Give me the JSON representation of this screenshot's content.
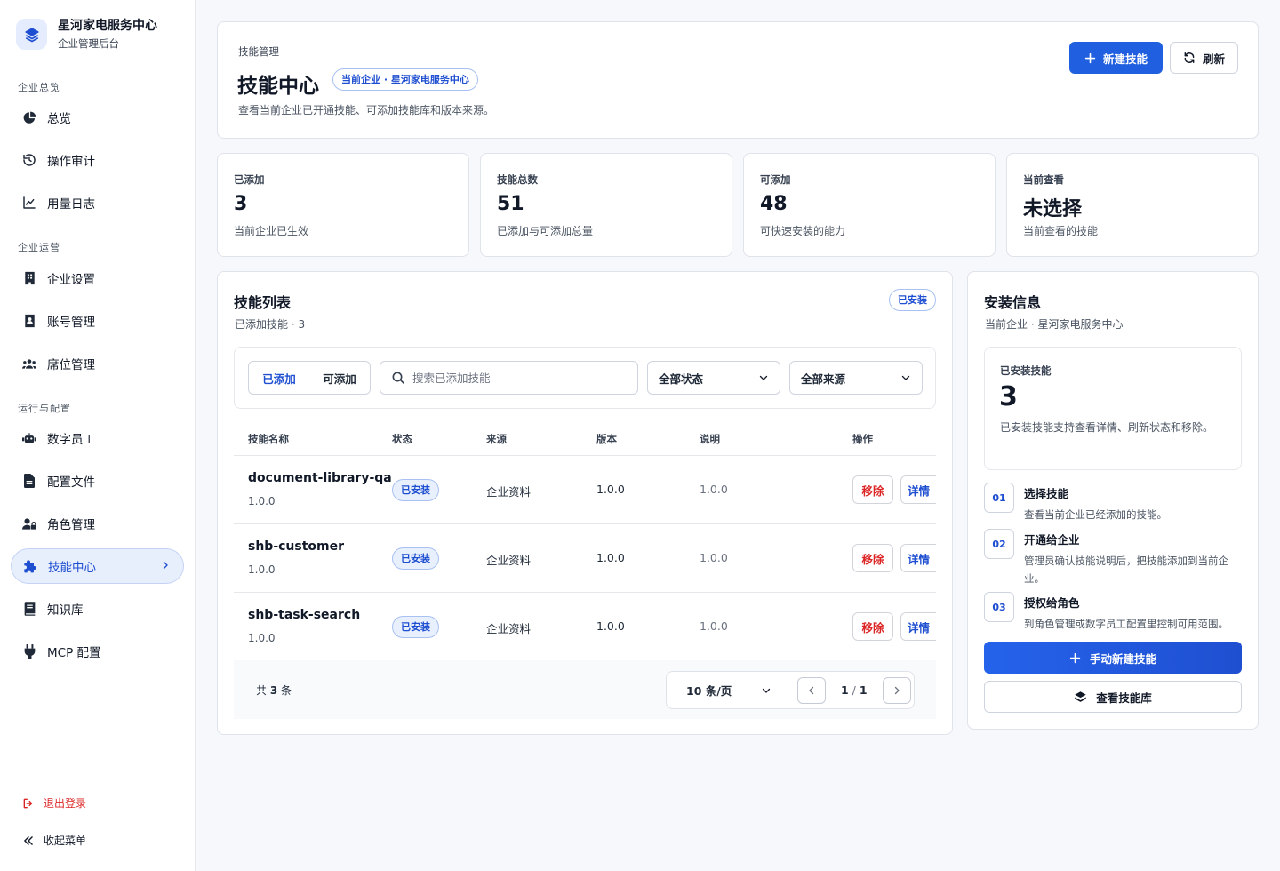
{
  "brand": {
    "name": "星河家电服务中心",
    "subtitle": "企业管理后台"
  },
  "sidebar": {
    "sections": [
      "企业总览",
      "企业运营",
      "运行与配置"
    ],
    "items": [
      {
        "label": "总览",
        "icon": "pie-chart-icon"
      },
      {
        "label": "操作审计",
        "icon": "history-icon"
      },
      {
        "label": "用量日志",
        "icon": "line-chart-icon"
      },
      {
        "label": "企业设置",
        "icon": "building-icon"
      },
      {
        "label": "账号管理",
        "icon": "id-card-icon"
      },
      {
        "label": "席位管理",
        "icon": "users-icon"
      },
      {
        "label": "数字员工",
        "icon": "robot-icon"
      },
      {
        "label": "配置文件",
        "icon": "file-icon"
      },
      {
        "label": "角色管理",
        "icon": "user-lock-icon"
      },
      {
        "label": "技能中心",
        "icon": "puzzle-icon",
        "active": true
      },
      {
        "label": "知识库",
        "icon": "book-icon"
      },
      {
        "label": "MCP 配置",
        "icon": "plug-icon"
      }
    ],
    "logout": "退出登录",
    "collapse": "收起菜单"
  },
  "header": {
    "breadcrumb": "技能管理",
    "title": "技能中心",
    "badge": "当前企业 · 星河家电服务中心",
    "description": "查看当前企业已开通技能、可添加技能库和版本来源。",
    "new_button": "新建技能",
    "refresh_button": "刷新"
  },
  "stats": [
    {
      "label": "已添加",
      "value": "3",
      "desc": "当前企业已生效"
    },
    {
      "label": "技能总数",
      "value": "51",
      "desc": "已添加与可添加总量"
    },
    {
      "label": "可添加",
      "value": "48",
      "desc": "可快速安装的能力"
    },
    {
      "label": "当前查看",
      "value": "未选择",
      "desc": "当前查看的技能"
    }
  ],
  "list": {
    "title": "技能列表",
    "subtitle": "已添加技能 · 3",
    "badge": "已安装",
    "tabs": [
      "已添加",
      "可添加"
    ],
    "search_placeholder": "搜索已添加技能",
    "status_filter": "全部状态",
    "source_filter": "全部来源",
    "columns": [
      "技能名称",
      "状态",
      "来源",
      "版本",
      "说明",
      "操作"
    ],
    "rows": [
      {
        "name": "document-library-qa",
        "version_sub": "1.0.0",
        "status": "已安装",
        "source": "企业资料",
        "version": "1.0.0",
        "desc": "1.0.0"
      },
      {
        "name": "shb-customer",
        "version_sub": "1.0.0",
        "status": "已安装",
        "source": "企业资料",
        "version": "1.0.0",
        "desc": "1.0.0"
      },
      {
        "name": "shb-task-search",
        "version_sub": "1.0.0",
        "status": "已安装",
        "source": "企业资料",
        "version": "1.0.0",
        "desc": "1.0.0"
      }
    ],
    "remove_label": "移除",
    "detail_label": "详情",
    "total_prefix": "共",
    "total_count": "3",
    "total_suffix": "条",
    "page_size": "10 条/页",
    "page_current": "1",
    "page_total": "1"
  },
  "info": {
    "title": "安装信息",
    "subtitle": "当前企业 · 星河家电服务中心",
    "box_label": "已安装技能",
    "box_value": "3",
    "box_desc": "已安装技能支持查看详情、刷新状态和移除。",
    "steps": [
      {
        "num": "01",
        "title": "选择技能",
        "desc": "查看当前企业已经添加的技能。"
      },
      {
        "num": "02",
        "title": "开通给企业",
        "desc": "管理员确认技能说明后，把技能添加到当前企业。"
      },
      {
        "num": "03",
        "title": "授权给角色",
        "desc": "到角色管理或数字员工配置里控制可用范围。"
      }
    ],
    "create_button": "手动新建技能",
    "library_button": "查看技能库"
  },
  "colors": {
    "accent": "#1f5fe0",
    "danger": "#dc2626",
    "active_bg": "#e7eefc"
  }
}
